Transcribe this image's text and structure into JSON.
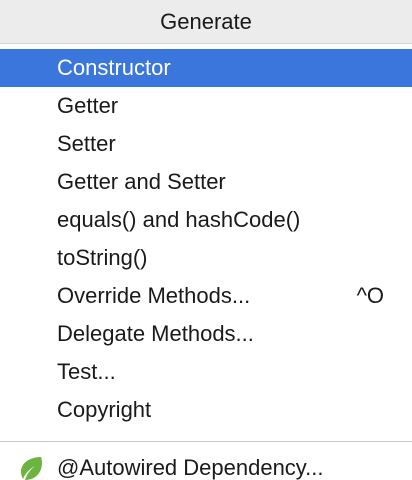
{
  "header": {
    "title": "Generate"
  },
  "menu": {
    "items": [
      {
        "label": "Constructor",
        "shortcut": ""
      },
      {
        "label": "Getter",
        "shortcut": ""
      },
      {
        "label": "Setter",
        "shortcut": ""
      },
      {
        "label": "Getter and Setter",
        "shortcut": ""
      },
      {
        "label": "equals() and hashCode()",
        "shortcut": ""
      },
      {
        "label": "toString()",
        "shortcut": ""
      },
      {
        "label": "Override Methods...",
        "shortcut": "^O"
      },
      {
        "label": "Delegate Methods...",
        "shortcut": ""
      },
      {
        "label": "Test...",
        "shortcut": ""
      },
      {
        "label": "Copyright",
        "shortcut": ""
      }
    ],
    "selected_index": 0
  },
  "extra": {
    "autowired_label": "@Autowired Dependency...",
    "icon": "spring-leaf-icon"
  },
  "colors": {
    "selection": "#3b76dc",
    "header_bg": "#ececec",
    "spring_green": "#6db33f"
  }
}
